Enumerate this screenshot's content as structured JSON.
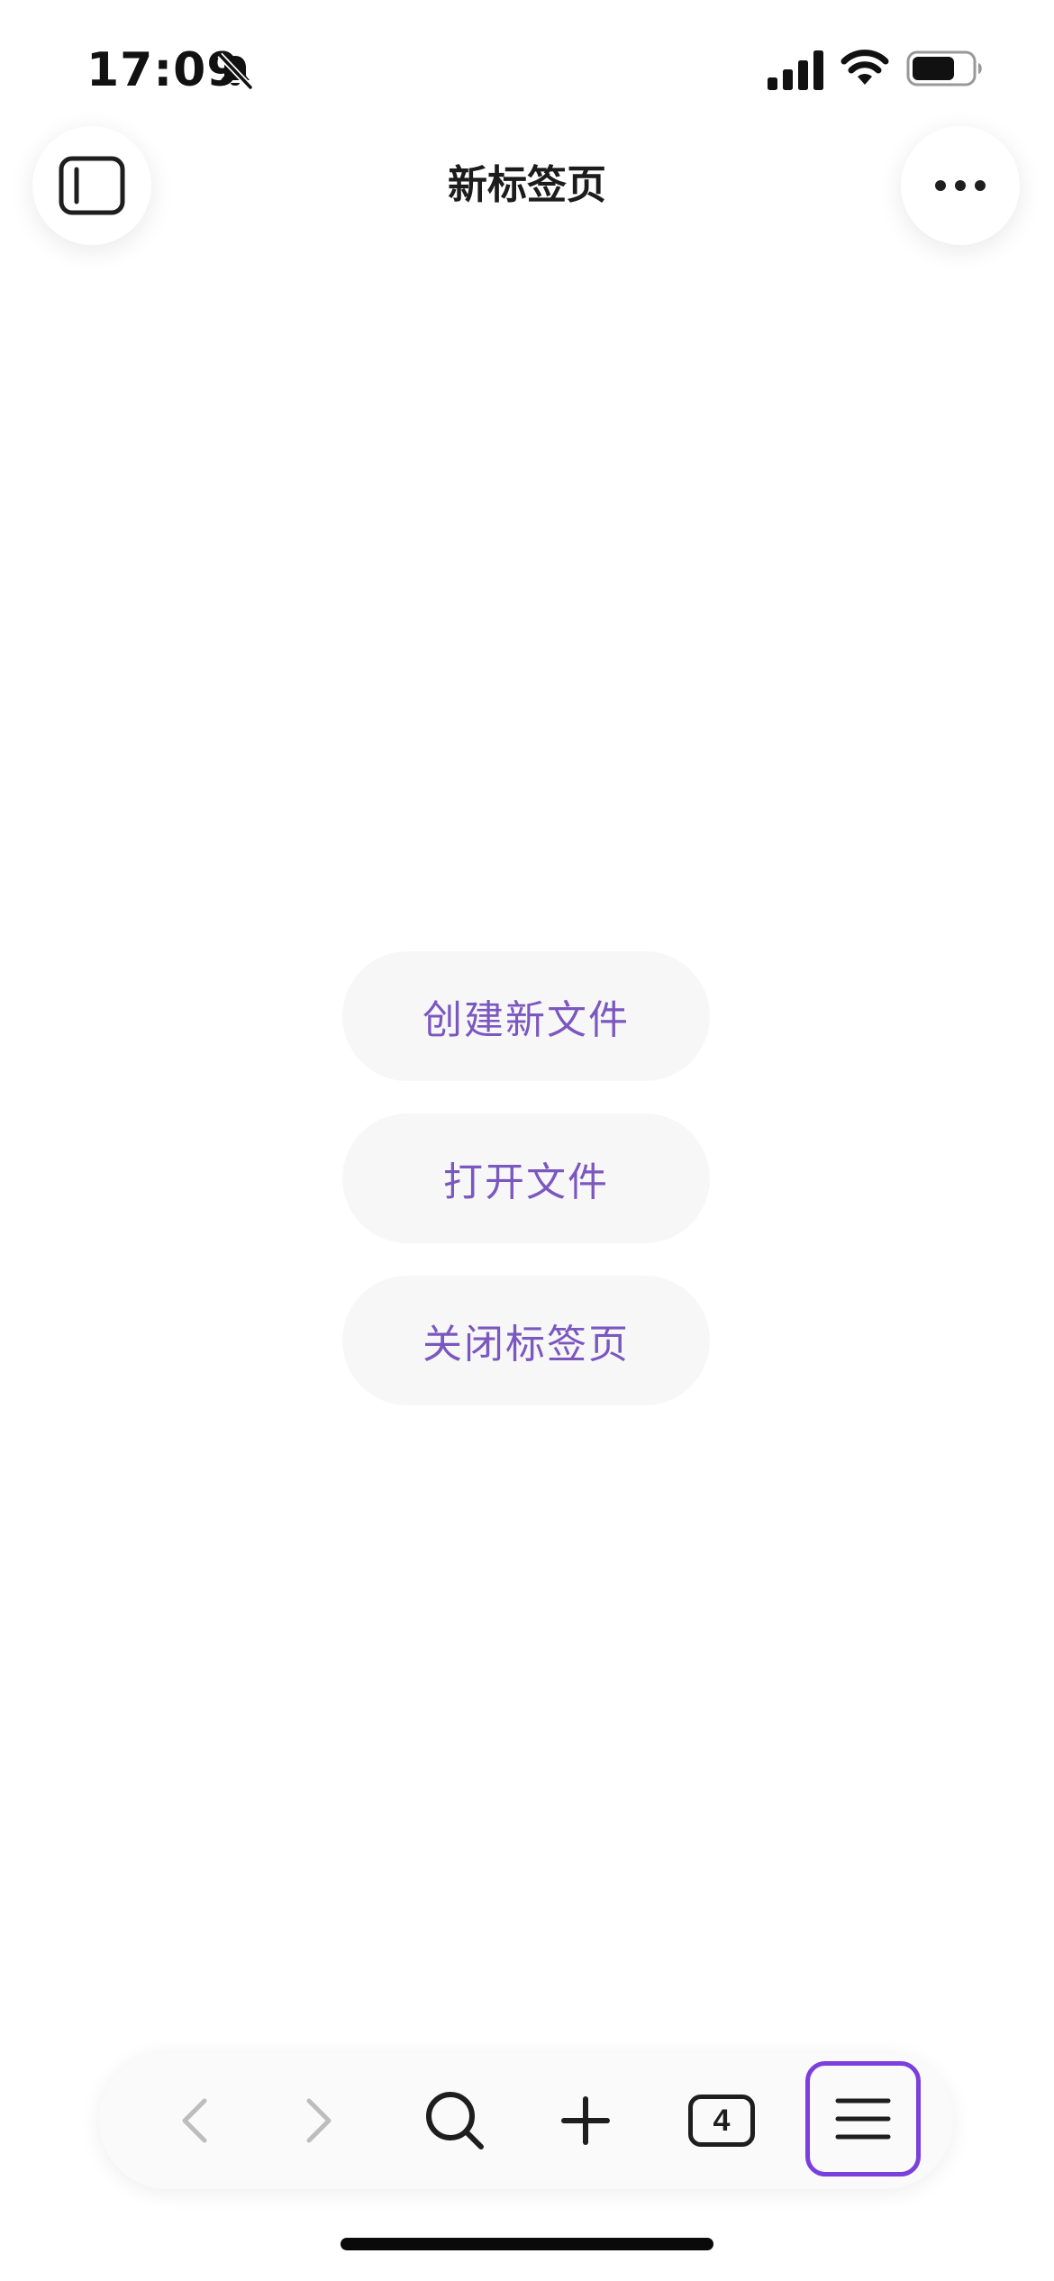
{
  "status_bar": {
    "time": "17:09",
    "icons": [
      "bell-slash-icon",
      "cellular-signal-icon",
      "wifi-icon",
      "battery-icon"
    ]
  },
  "header": {
    "title": "新标签页",
    "left_icon": "sidebar-icon",
    "right_icon": "more-horizontal-icon"
  },
  "actions": {
    "create_new_file": "创建新文件",
    "open_file": "打开文件",
    "close_tab": "关闭标签页"
  },
  "toolbar": {
    "tab_count": "4",
    "items": [
      "back-arrow-icon",
      "forward-arrow-icon",
      "search-icon",
      "plus-icon",
      "tabs-icon",
      "menu-icon"
    ],
    "highlight_color": "#7a3fdc"
  },
  "colors": {
    "accent_text": "#7b57c0",
    "button_bg": "#f7f7f7"
  }
}
